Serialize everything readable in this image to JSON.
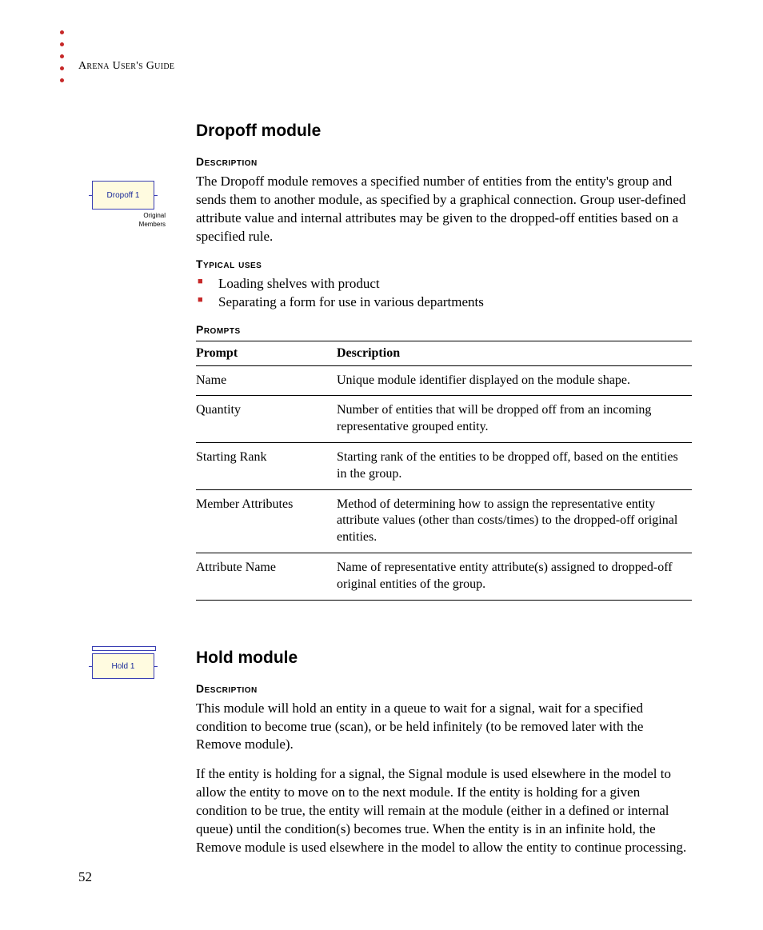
{
  "running_header": "Arena User's Guide",
  "page_number": "52",
  "dropoff": {
    "title": "Dropoff module",
    "icon_label": "Dropoff 1",
    "icon_sub1": "Original",
    "icon_sub2": "Members",
    "description_heading": "Description",
    "description_text": "The Dropoff module removes a specified number of entities from the entity's group and sends them to another module, as specified by a graphical connection. Group user-defined attribute value and internal attributes may be given to the dropped-off entities based on a specified rule.",
    "typical_uses_heading": "Typical uses",
    "typical_uses": [
      "Loading shelves with product",
      "Separating a form for use in various departments"
    ],
    "prompts_heading": "Prompts",
    "table_headers": {
      "c1": "Prompt",
      "c2": "Description"
    },
    "table_rows": [
      {
        "prompt": "Name",
        "desc": "Unique module identifier displayed on the module shape."
      },
      {
        "prompt": "Quantity",
        "desc": "Number of entities that will be dropped off from an incoming representative grouped entity."
      },
      {
        "prompt": "Starting Rank",
        "desc": "Starting rank of the entities to be dropped off, based on the entities in the group."
      },
      {
        "prompt": "Member Attributes",
        "desc": "Method of determining how to assign the representative entity attribute values (other than costs/times) to the dropped-off original entities."
      },
      {
        "prompt": "Attribute Name",
        "desc": "Name of representative entity attribute(s) assigned to dropped-off original entities of the group."
      }
    ]
  },
  "hold": {
    "title": "Hold module",
    "icon_label": "Hold 1",
    "description_heading": "Description",
    "description_p1": "This module will hold an entity in a queue to wait for a signal, wait for a specified condition to become true (scan), or be held infinitely (to be removed later with the Remove module).",
    "description_p2": "If the entity is holding for a signal, the Signal module is used elsewhere in the model to allow the entity to move on to the next module. If the entity is holding for a given condition to be true, the entity will remain at the module (either in a defined or internal queue) until the condition(s) becomes true. When the entity is in an infinite hold, the Remove module is used elsewhere in the model to allow the entity to continue processing."
  }
}
